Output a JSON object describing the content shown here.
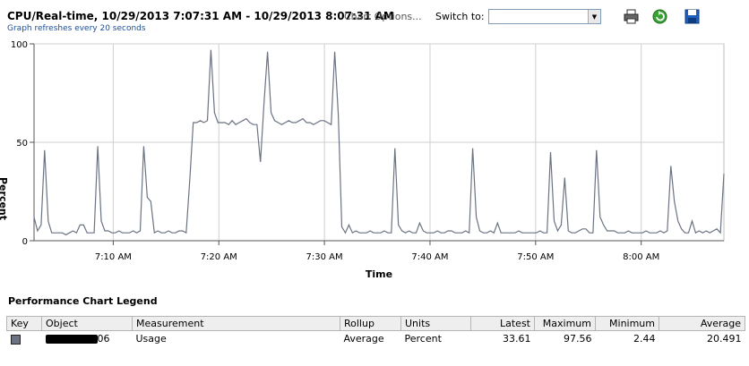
{
  "header": {
    "title": "CPU/Real-time, 10/29/2013 7:07:31 AM - 10/29/2013 8:07:31 AM",
    "chart_options": "Chart Options...",
    "refresh_note": "Graph refreshes every 20 seconds",
    "switch_label": "Switch to:",
    "switch_value": "",
    "icons": [
      "printer-icon",
      "refresh-icon",
      "save-icon"
    ]
  },
  "chart_data": {
    "type": "line",
    "xlabel": "Time",
    "ylabel": "Percent",
    "ylim": [
      0,
      100
    ],
    "yticks": [
      0,
      50,
      100
    ],
    "xticks": [
      "7:10 AM",
      "7:20 AM",
      "7:30 AM",
      "7:40 AM",
      "7:50 AM",
      "8:00 AM"
    ],
    "x_start_minutes": 7.5,
    "x_interval_seconds": 20,
    "grid": true,
    "series": [
      {
        "color": "#6b7383",
        "values": [
          12,
          5,
          8,
          46,
          10,
          4,
          4,
          4,
          4,
          3,
          4,
          5,
          4,
          8,
          8,
          4,
          4,
          4,
          48,
          10,
          5,
          5,
          4,
          4,
          5,
          4,
          4,
          4,
          5,
          4,
          5,
          48,
          22,
          20,
          4,
          5,
          4,
          4,
          5,
          4,
          4,
          5,
          5,
          4,
          30,
          60,
          60,
          61,
          60,
          61,
          97,
          65,
          60,
          60,
          60,
          59,
          61,
          59,
          60,
          61,
          62,
          60,
          59,
          59,
          40,
          70,
          96,
          65,
          61,
          60,
          59,
          60,
          61,
          60,
          60,
          61,
          62,
          60,
          60,
          59,
          60,
          61,
          61,
          60,
          59,
          96,
          64,
          7,
          4,
          8,
          4,
          5,
          4,
          4,
          4,
          5,
          4,
          4,
          4,
          5,
          4,
          4,
          47,
          8,
          5,
          4,
          5,
          4,
          4,
          9,
          5,
          4,
          4,
          4,
          5,
          4,
          4,
          5,
          5,
          4,
          4,
          4,
          5,
          4,
          47,
          12,
          5,
          4,
          4,
          5,
          4,
          9,
          4,
          4,
          4,
          4,
          4,
          5,
          4,
          4,
          4,
          4,
          4,
          5,
          4,
          4,
          45,
          10,
          5,
          8,
          32,
          5,
          4,
          4,
          5,
          6,
          6,
          4,
          4,
          46,
          12,
          8,
          5,
          5,
          5,
          4,
          4,
          4,
          5,
          4,
          4,
          4,
          4,
          5,
          4,
          4,
          4,
          5,
          4,
          5,
          38,
          20,
          10,
          6,
          4,
          4,
          10,
          4,
          5,
          4,
          5,
          4,
          5,
          6,
          4,
          34
        ]
      }
    ]
  },
  "legend": {
    "title": "Performance Chart Legend",
    "columns": [
      "Key",
      "Object",
      "Measurement",
      "Rollup",
      "Units",
      "Latest",
      "Maximum",
      "Minimum",
      "Average"
    ],
    "rows": [
      {
        "key_color": "#6b7383",
        "object_suffix": "06",
        "measurement": "Usage",
        "rollup": "Average",
        "units": "Percent",
        "latest": "33.61",
        "maximum": "97.56",
        "minimum": "2.44",
        "average": "20.491"
      }
    ]
  }
}
